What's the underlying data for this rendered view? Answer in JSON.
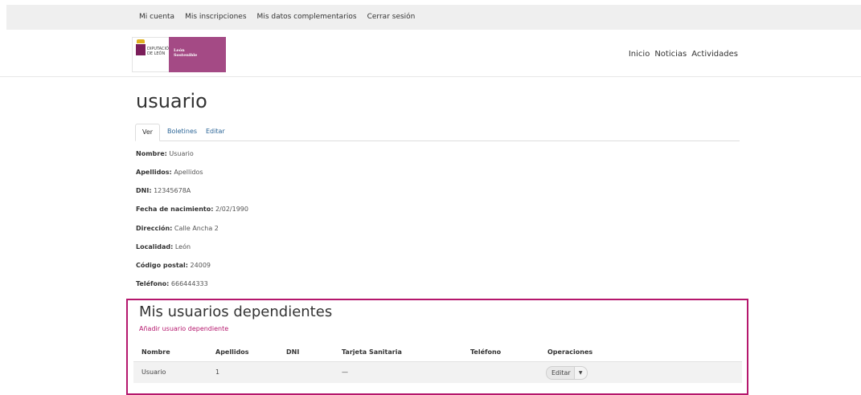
{
  "topbar": {
    "links": [
      "Mi cuenta",
      "Mis inscripciones",
      "Mis datos complementarios",
      "Cerrar sesión"
    ]
  },
  "logo": {
    "line1": "DIPUTACIÓN",
    "line2": "DE LEÓN",
    "secondary_line1": "León",
    "secondary_line2": "Sostenible"
  },
  "nav": [
    "Inicio",
    "Noticias",
    "Actividades"
  ],
  "page": {
    "title": "usuario"
  },
  "tabs": [
    "Ver",
    "Boletines",
    "Editar"
  ],
  "fields": [
    {
      "label": "Nombre:",
      "value": "Usuario"
    },
    {
      "label": "Apellidos:",
      "value": "Apellidos"
    },
    {
      "label": "DNI:",
      "value": "12345678A"
    },
    {
      "label": "Fecha de nacimiento:",
      "value": "2/02/1990"
    },
    {
      "label": "Dirección:",
      "value": "Calle Ancha 2"
    },
    {
      "label": "Localidad:",
      "value": "León"
    },
    {
      "label": "Código postal:",
      "value": "24009"
    },
    {
      "label": "Teléfono:",
      "value": "666444333"
    }
  ],
  "dependents": {
    "title": "Mis usuarios dependientes",
    "add_link": "Añadir usuario dependiente",
    "columns": [
      "Nombre",
      "Apellidos",
      "DNI",
      "Tarjeta Sanitaria",
      "Teléfono",
      "Operaciones"
    ],
    "rows": [
      {
        "nombre": "Usuario",
        "apellidos": "1",
        "dni": "",
        "tarjeta": "—",
        "telefono": "",
        "op": "Editar"
      }
    ]
  },
  "colors": {
    "accent": "#b5176d",
    "logo_purple": "#a44a85",
    "link": "#2a6496"
  }
}
